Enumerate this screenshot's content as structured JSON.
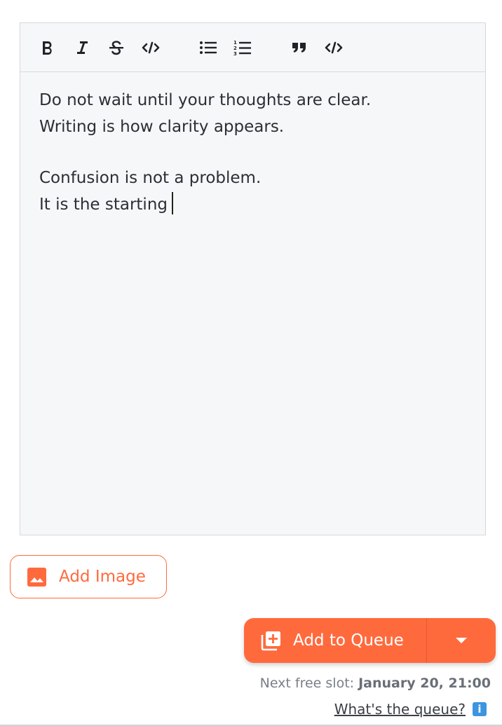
{
  "toolbar": {
    "buttons": [
      {
        "name": "bold",
        "icon": "bold-icon"
      },
      {
        "name": "italic",
        "icon": "italic-icon"
      },
      {
        "name": "strikethrough",
        "icon": "strikethrough-icon"
      },
      {
        "name": "inline-code",
        "icon": "code-icon"
      },
      {
        "name": "bullet-list",
        "icon": "bullet-list-icon"
      },
      {
        "name": "numbered-list",
        "icon": "numbered-list-icon"
      },
      {
        "name": "quote",
        "icon": "quote-icon"
      },
      {
        "name": "code-block",
        "icon": "code-icon"
      }
    ]
  },
  "editor": {
    "lines": [
      "Do not wait until your thoughts are clear.",
      "Writing is how clarity appears.",
      "",
      "Confusion is not a problem.",
      "It is the starting"
    ]
  },
  "actions": {
    "add_image_label": "Add Image",
    "add_image_icon": "image-icon",
    "add_to_queue_label": "Add to Queue",
    "add_to_queue_icon": "queue-add-icon",
    "dropdown_icon": "caret-down-icon"
  },
  "schedule": {
    "next_slot_prefix": "Next free slot: ",
    "next_slot_value": "January 20, 21:00",
    "help_link": "What's the queue?",
    "info_glyph": "i"
  },
  "colors": {
    "accent": "#ff6a3d",
    "editor_bg": "#f6f7f9",
    "info_blue": "#3d95e0"
  }
}
